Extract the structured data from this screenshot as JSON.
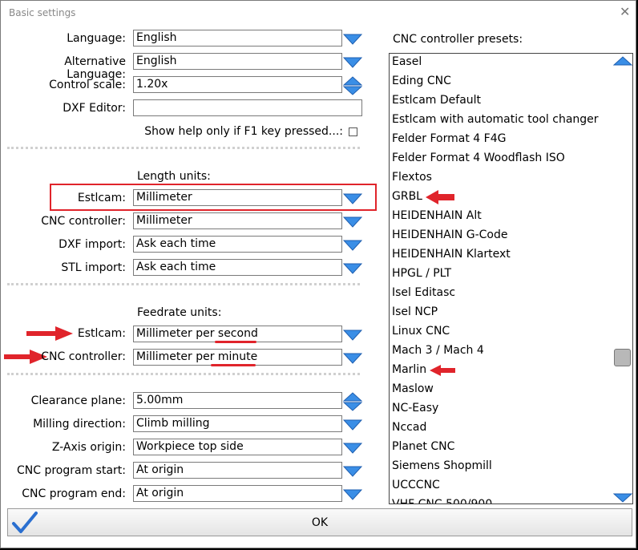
{
  "window": {
    "title": "Basic settings"
  },
  "general": {
    "language": {
      "label": "Language:",
      "value": "English"
    },
    "alt_language": {
      "label": "Alternative Language:",
      "value": "English"
    },
    "control_scale": {
      "label": "Control scale:",
      "value": "1.20x"
    },
    "dxf_editor": {
      "label": "DXF Editor:",
      "value": ""
    },
    "help_only_f1": {
      "label": "Show help only if F1 key pressed...:",
      "checked": false
    }
  },
  "length_units": {
    "heading": "Length units:",
    "estlcam": {
      "label": "Estlcam:",
      "value": "Millimeter"
    },
    "cnc_controller": {
      "label": "CNC controller:",
      "value": "Millimeter"
    },
    "dxf_import": {
      "label": "DXF import:",
      "value": "Ask each time"
    },
    "stl_import": {
      "label": "STL import:",
      "value": "Ask each time"
    }
  },
  "feedrate_units": {
    "heading": "Feedrate units:",
    "estlcam": {
      "label": "Estlcam:",
      "value": "Millimeter per second"
    },
    "cnc_controller": {
      "label": "CNC controller:",
      "value": "Millimeter per minute"
    }
  },
  "misc": {
    "clearance_plane": {
      "label": "Clearance plane:",
      "value": "5.00mm"
    },
    "milling_direction": {
      "label": "Milling direction:",
      "value": "Climb milling"
    },
    "z_axis_origin": {
      "label": "Z-Axis origin:",
      "value": "Workpiece top side"
    },
    "program_start": {
      "label": "CNC program start:",
      "value": "At origin"
    },
    "program_end": {
      "label": "CNC program end:",
      "value": "At origin"
    }
  },
  "presets": {
    "label": "CNC controller presets:",
    "items": [
      "Easel",
      "Eding CNC",
      "Estlcam Default",
      "Estlcam with automatic tool changer",
      "Felder Format 4 F4G",
      "Felder Format 4 Woodflash ISO",
      "Flextos",
      "GRBL",
      "HEIDENHAIN Alt",
      "HEIDENHAIN G-Code",
      "HEIDENHAIN Klartext",
      "HPGL / PLT",
      "Isel Editasc",
      "Isel NCP",
      "Linux CNC",
      "Mach 3 / Mach 4",
      "Marlin",
      "Maslow",
      "NC-Easy",
      "Nccad",
      "Planet CNC",
      "Siemens Shopmill",
      "UCCCNC",
      "VHF CNC 500/900"
    ]
  },
  "buttons": {
    "ok": "OK"
  },
  "colors": {
    "accent_blue": "#3a8ee6",
    "annotation_red": "#e0242b"
  }
}
